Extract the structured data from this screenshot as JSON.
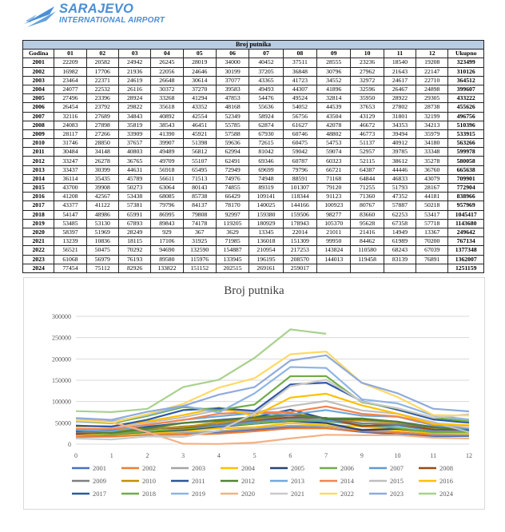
{
  "logo": {
    "name": "SARAJEVO",
    "subtitle": "INTERNATIONAL AIRPORT"
  },
  "table": {
    "title": "Broj putnika",
    "headers": [
      "Godina",
      "01",
      "02",
      "03",
      "04",
      "05",
      "06",
      "07",
      "08",
      "09",
      "10",
      "11",
      "12",
      "Ukupno"
    ],
    "rows": [
      [
        "2001",
        "22209",
        "20582",
        "24942",
        "26245",
        "28019",
        "34000",
        "40452",
        "37511",
        "28555",
        "23236",
        "18540",
        "19208",
        "323499"
      ],
      [
        "2002",
        "16982",
        "17706",
        "21936",
        "22056",
        "24646",
        "30199",
        "37205",
        "36848",
        "30796",
        "27962",
        "21643",
        "22147",
        "310126"
      ],
      [
        "2003",
        "23464",
        "22371",
        "24619",
        "26648",
        "30614",
        "37077",
        "43365",
        "41723",
        "34552",
        "32972",
        "24617",
        "22710",
        "364512"
      ],
      [
        "2004",
        "24077",
        "22532",
        "26116",
        "30372",
        "37270",
        "39583",
        "49493",
        "44307",
        "41896",
        "32596",
        "26467",
        "24898",
        "399607"
      ],
      [
        "2005",
        "27496",
        "23396",
        "28924",
        "33268",
        "41294",
        "47853",
        "54476",
        "49524",
        "32814",
        "35950",
        "28922",
        "29305",
        "433222"
      ],
      [
        "2006",
        "26454",
        "23792",
        "29822",
        "35618",
        "43352",
        "48168",
        "55636",
        "54052",
        "44539",
        "37653",
        "27802",
        "28738",
        "455626"
      ],
      [
        "2007",
        "32116",
        "27689",
        "34843",
        "40892",
        "42554",
        "52349",
        "58924",
        "56756",
        "43504",
        "43129",
        "31801",
        "32199",
        "496756"
      ],
      [
        "2008",
        "24083",
        "27898",
        "35819",
        "38543",
        "46451",
        "55785",
        "62874",
        "61627",
        "42078",
        "46672",
        "34353",
        "34213",
        "510396"
      ],
      [
        "2009",
        "28117",
        "27266",
        "33909",
        "41390",
        "45921",
        "57588",
        "67930",
        "60746",
        "48802",
        "46773",
        "39494",
        "35979",
        "533915"
      ],
      [
        "2010",
        "31746",
        "28850",
        "37657",
        "39907",
        "51398",
        "59636",
        "72615",
        "60475",
        "54753",
        "51137",
        "40912",
        "34180",
        "563266"
      ],
      [
        "2011",
        "30484",
        "34148",
        "40803",
        "49489",
        "56812",
        "62994",
        "81042",
        "59042",
        "59074",
        "52957",
        "39785",
        "33348",
        "599978"
      ],
      [
        "2012",
        "33247",
        "26278",
        "36765",
        "49709",
        "55107",
        "62491",
        "69346",
        "60787",
        "60323",
        "52115",
        "38612",
        "35278",
        "580058"
      ],
      [
        "2013",
        "33437",
        "30399",
        "44631",
        "56918",
        "65495",
        "72949",
        "69699",
        "79796",
        "66721",
        "64387",
        "44446",
        "36760",
        "665638"
      ],
      [
        "2014",
        "36114",
        "35435",
        "45789",
        "56611",
        "71513",
        "74976",
        "74948",
        "88591",
        "71168",
        "64844",
        "46833",
        "43079",
        "709901"
      ],
      [
        "2015",
        "43700",
        "39908",
        "50273",
        "63064",
        "80143",
        "74855",
        "89319",
        "101307",
        "79120",
        "71255",
        "51793",
        "28167",
        "772904"
      ],
      [
        "2016",
        "41208",
        "42567",
        "53438",
        "68085",
        "85738",
        "66429",
        "109141",
        "118344",
        "91123",
        "71360",
        "47352",
        "44181",
        "838966"
      ],
      [
        "2017",
        "43377",
        "41122",
        "57381",
        "79796",
        "84137",
        "78170",
        "140025",
        "144166",
        "100923",
        "80767",
        "57887",
        "50218",
        "957969"
      ],
      [
        "2018",
        "54147",
        "48986",
        "65991",
        "86995",
        "79808",
        "92997",
        "159380",
        "159506",
        "98277",
        "83660",
        "62253",
        "53417",
        "1045417"
      ],
      [
        "2019",
        "53485",
        "53130",
        "67893",
        "89843",
        "74178",
        "119205",
        "180929",
        "178943",
        "105370",
        "95628",
        "67358",
        "57718",
        "1143680"
      ],
      [
        "2020",
        "58397",
        "51969",
        "28249",
        "929",
        "367",
        "3629",
        "13345",
        "22014",
        "21011",
        "21416",
        "14949",
        "13367",
        "249642"
      ],
      [
        "2021",
        "13239",
        "10836",
        "18115",
        "17106",
        "31925",
        "71985",
        "136018",
        "151309",
        "99950",
        "84462",
        "61989",
        "70200",
        "767134"
      ],
      [
        "2022",
        "56521",
        "50475",
        "70292",
        "94690",
        "132590",
        "154887",
        "210954",
        "217253",
        "143824",
        "110580",
        "68243",
        "67039",
        "1377348"
      ],
      [
        "2023",
        "61068",
        "56979",
        "76193",
        "89580",
        "115976",
        "133945",
        "196195",
        "208570",
        "144013",
        "119458",
        "83139",
        "76891",
        "1362007"
      ],
      [
        "2024",
        "77454",
        "75112",
        "82926",
        "133822",
        "151152",
        "202515",
        "269161",
        "259017",
        "",
        "",
        "",
        "",
        "1251159"
      ]
    ]
  },
  "chart_data": {
    "type": "line",
    "title": "Broj putnika",
    "x": [
      "0",
      "1",
      "2",
      "3",
      "4",
      "5",
      "6",
      "7",
      "9",
      "10",
      "11",
      "12"
    ],
    "ylim": [
      0,
      300000
    ],
    "yticks": [
      "0",
      "50000",
      "100000",
      "150000",
      "200000",
      "250000",
      "300000"
    ],
    "grid": true,
    "legend_position": "bottom",
    "series": [
      {
        "name": "2001",
        "color": "#4472c4",
        "values": [
          22209,
          20582,
          24942,
          26245,
          28019,
          34000,
          40452,
          37511,
          28555,
          23236,
          18540,
          19208
        ]
      },
      {
        "name": "2002",
        "color": "#ed7d31",
        "values": [
          16982,
          17706,
          21936,
          22056,
          24646,
          30199,
          37205,
          36848,
          30796,
          27962,
          21643,
          22147
        ]
      },
      {
        "name": "2003",
        "color": "#a5a5a5",
        "values": [
          23464,
          22371,
          24619,
          26648,
          30614,
          37077,
          43365,
          41723,
          34552,
          32972,
          24617,
          22710
        ]
      },
      {
        "name": "2004",
        "color": "#ffc000",
        "values": [
          24077,
          22532,
          26116,
          30372,
          37270,
          39583,
          49493,
          44307,
          41896,
          32596,
          26467,
          24898
        ]
      },
      {
        "name": "2005",
        "color": "#264478",
        "values": [
          27496,
          23396,
          28924,
          33268,
          41294,
          47853,
          54476,
          49524,
          32814,
          35950,
          28922,
          29305
        ]
      },
      {
        "name": "2006",
        "color": "#70ad47",
        "values": [
          26454,
          23792,
          29822,
          35618,
          43352,
          48168,
          55636,
          54052,
          44539,
          37653,
          27802,
          28738
        ]
      },
      {
        "name": "2007",
        "color": "#5b9bd5",
        "values": [
          32116,
          27689,
          34843,
          40892,
          42554,
          52349,
          58924,
          56756,
          43504,
          43129,
          31801,
          32199
        ]
      },
      {
        "name": "2008",
        "color": "#9e480e",
        "values": [
          24083,
          27898,
          35819,
          38543,
          46451,
          55785,
          62874,
          61627,
          42078,
          46672,
          34353,
          34213
        ]
      },
      {
        "name": "2009",
        "color": "#7f7f7f",
        "values": [
          28117,
          27266,
          33909,
          41390,
          45921,
          57588,
          67930,
          60746,
          48802,
          46773,
          39494,
          35979
        ]
      },
      {
        "name": "2010",
        "color": "#bf9000",
        "values": [
          31746,
          28850,
          37657,
          39907,
          51398,
          59636,
          72615,
          60475,
          54753,
          51137,
          40912,
          34180
        ]
      },
      {
        "name": "2011",
        "color": "#2f5597",
        "values": [
          30484,
          34148,
          40803,
          49489,
          56812,
          62994,
          81042,
          59042,
          59074,
          52957,
          39785,
          33348
        ]
      },
      {
        "name": "2012",
        "color": "#548235",
        "values": [
          33247,
          26278,
          36765,
          49709,
          55107,
          62491,
          69346,
          60787,
          60323,
          52115,
          38612,
          35278
        ]
      },
      {
        "name": "2013",
        "color": "#6fa8dc",
        "values": [
          33437,
          30399,
          44631,
          56918,
          65495,
          72949,
          69699,
          79796,
          66721,
          64387,
          44446,
          36760
        ]
      },
      {
        "name": "2014",
        "color": "#f4844c",
        "values": [
          36114,
          35435,
          45789,
          56611,
          71513,
          74976,
          74948,
          88591,
          71168,
          64844,
          46833,
          43079
        ]
      },
      {
        "name": "2015",
        "color": "#bfbfbf",
        "values": [
          43700,
          39908,
          50273,
          63064,
          80143,
          74855,
          89319,
          101307,
          79120,
          71255,
          51793,
          28167
        ]
      },
      {
        "name": "2016",
        "color": "#ffc000",
        "values": [
          41208,
          42567,
          53438,
          68085,
          85738,
          66429,
          109141,
          118344,
          91123,
          71360,
          47352,
          44181
        ]
      },
      {
        "name": "2017",
        "color": "#2e58a6",
        "values": [
          43377,
          41122,
          57381,
          79796,
          84137,
          78170,
          140025,
          144166,
          100923,
          80767,
          57887,
          50218
        ]
      },
      {
        "name": "2018",
        "color": "#70ad47",
        "values": [
          54147,
          48986,
          65991,
          86995,
          79808,
          92997,
          159380,
          159506,
          98277,
          83660,
          62253,
          53417
        ]
      },
      {
        "name": "2019",
        "color": "#8eb4e3",
        "values": [
          53485,
          53130,
          67893,
          89843,
          74178,
          119205,
          180929,
          178943,
          105370,
          95628,
          67358,
          57718
        ]
      },
      {
        "name": "2020",
        "color": "#f4b183",
        "values": [
          58397,
          51969,
          28249,
          929,
          367,
          3629,
          13345,
          22014,
          21011,
          21416,
          14949,
          13367
        ]
      },
      {
        "name": "2021",
        "color": "#c9c9c9",
        "values": [
          13239,
          10836,
          18115,
          17106,
          31925,
          71985,
          136018,
          151309,
          99950,
          84462,
          61989,
          70200
        ]
      },
      {
        "name": "2022",
        "color": "#ffd966",
        "values": [
          56521,
          50475,
          70292,
          94690,
          132590,
          154887,
          210954,
          217253,
          143824,
          110580,
          68243,
          67039
        ]
      },
      {
        "name": "2023",
        "color": "#8faadc",
        "values": [
          61068,
          56979,
          76193,
          89580,
          115976,
          133945,
          196195,
          208570,
          144013,
          119458,
          83139,
          76891
        ]
      },
      {
        "name": "2024",
        "color": "#a9d18e",
        "values": [
          77454,
          75112,
          82926,
          133822,
          151152,
          202515,
          269161,
          259017,
          null,
          null,
          null,
          null
        ]
      }
    ]
  }
}
